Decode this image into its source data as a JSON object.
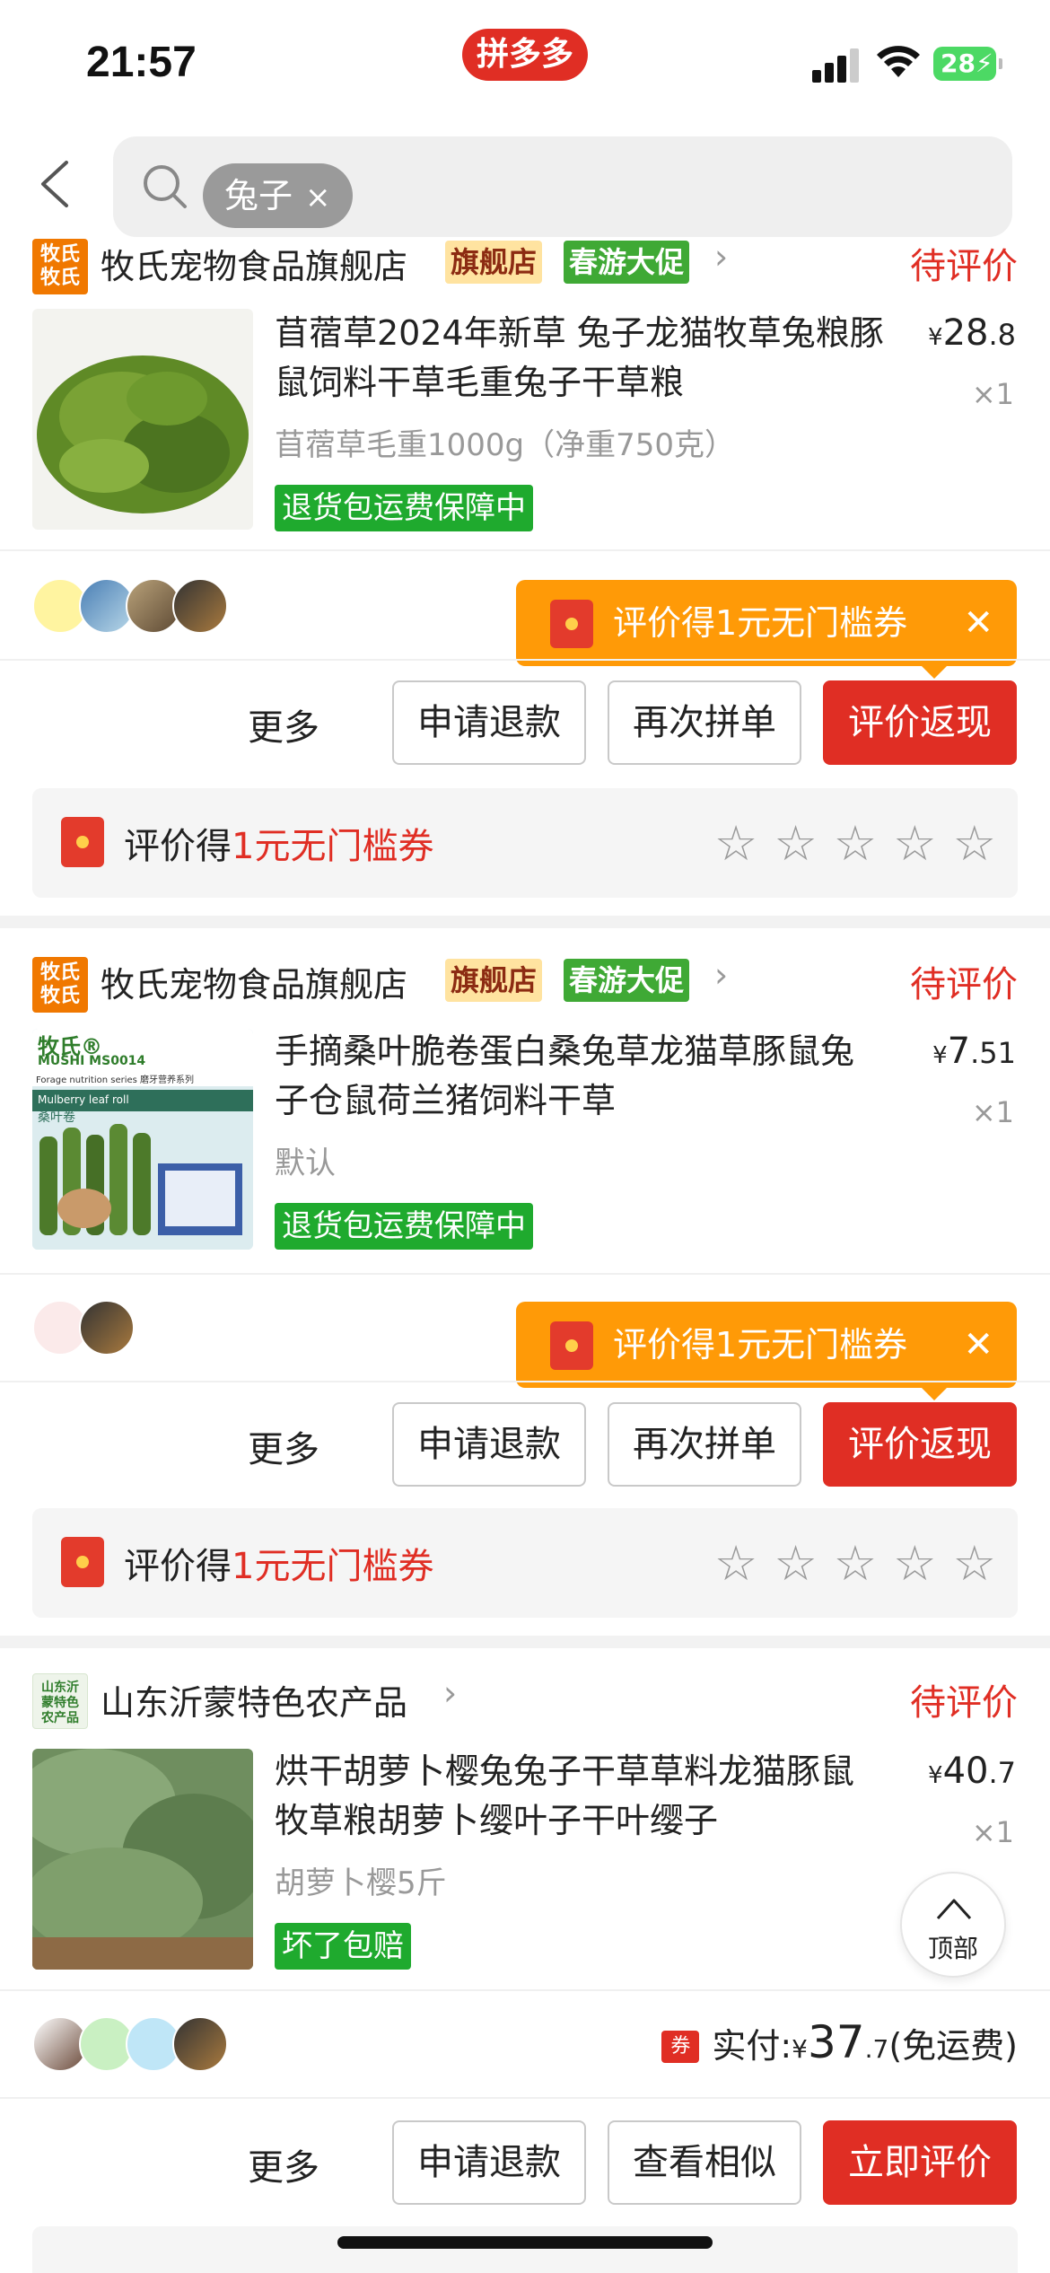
{
  "status_bar": {
    "time": "21:57",
    "app_badge": "拼多多",
    "battery": "28"
  },
  "search": {
    "chip_label": "兔子",
    "chip_close": "×"
  },
  "orders": [
    {
      "shop_logo": "牧氏牧氏",
      "shop_name": "牧氏宠物食品旗舰店",
      "tag_flagship": "旗舰店",
      "tag_promo": "春游大促",
      "status": "待评价",
      "product_title": "苜蓿草2024年新草 兔子龙猫牧草兔粮豚鼠饲料干草毛重兔子干草粮",
      "spec": "苜蓿草毛重1000g（净重750克）",
      "guarantee": "退货包运费保障中",
      "price_symbol": "¥",
      "price_int": "28",
      "price_dec": ".8",
      "qty": "×1",
      "tooltip": "评价得1元无门槛券",
      "tooltip_close": "✕",
      "actions": {
        "more": "更多",
        "b1": "申请退款",
        "b2": "再次拼单",
        "b3": "评价返现"
      },
      "review_prefix": "评价得",
      "review_highlight": "1元无门槛券"
    },
    {
      "shop_logo": "牧氏牧氏",
      "shop_name": "牧氏宠物食品旗舰店",
      "tag_flagship": "旗舰店",
      "tag_promo": "春游大促",
      "status": "待评价",
      "product_title": "手摘桑叶脆卷蛋白桑兔草龙猫草豚鼠兔子仓鼠荷兰猪饲料干草",
      "spec": "默认",
      "guarantee": "退货包运费保障中",
      "price_symbol": "¥",
      "price_int": "7",
      "price_dec": ".51",
      "qty": "×1",
      "tooltip": "评价得1元无门槛券",
      "tooltip_close": "✕",
      "actions": {
        "more": "更多",
        "b1": "申请退款",
        "b2": "再次拼单",
        "b3": "评价返现"
      },
      "review_prefix": "评价得",
      "review_highlight": "1元无门槛券",
      "img_label": {
        "brand": "牧氏®",
        "en": "MUSHI MS0014",
        "series_en": "Forage nutrition series 磨牙营养系列",
        "roll": "Mulberry leaf roll",
        "cn": "桑叶卷"
      }
    },
    {
      "shop_logo": "山东沂蒙特色农产品",
      "shop_name": "山东沂蒙特色农产品",
      "status": "待评价",
      "product_title": "烘干胡萝卜樱兔兔子干草草料龙猫豚鼠牧草粮胡萝卜缨叶子干叶缨子",
      "spec": "胡萝卜樱5斤",
      "guarantee": "坏了包赔",
      "price_symbol": "¥",
      "price_int": "40",
      "price_dec": ".7",
      "qty": "×1",
      "paid_coupon": "券",
      "paid_label": "实付:",
      "paid_symbol": "¥",
      "paid_int": "37",
      "paid_dec": ".7",
      "paid_note": "(免运费)",
      "actions": {
        "more": "更多",
        "b1": "申请退款",
        "b2": "查看相似",
        "b3": "立即评价"
      }
    }
  ],
  "top_button": "顶部"
}
